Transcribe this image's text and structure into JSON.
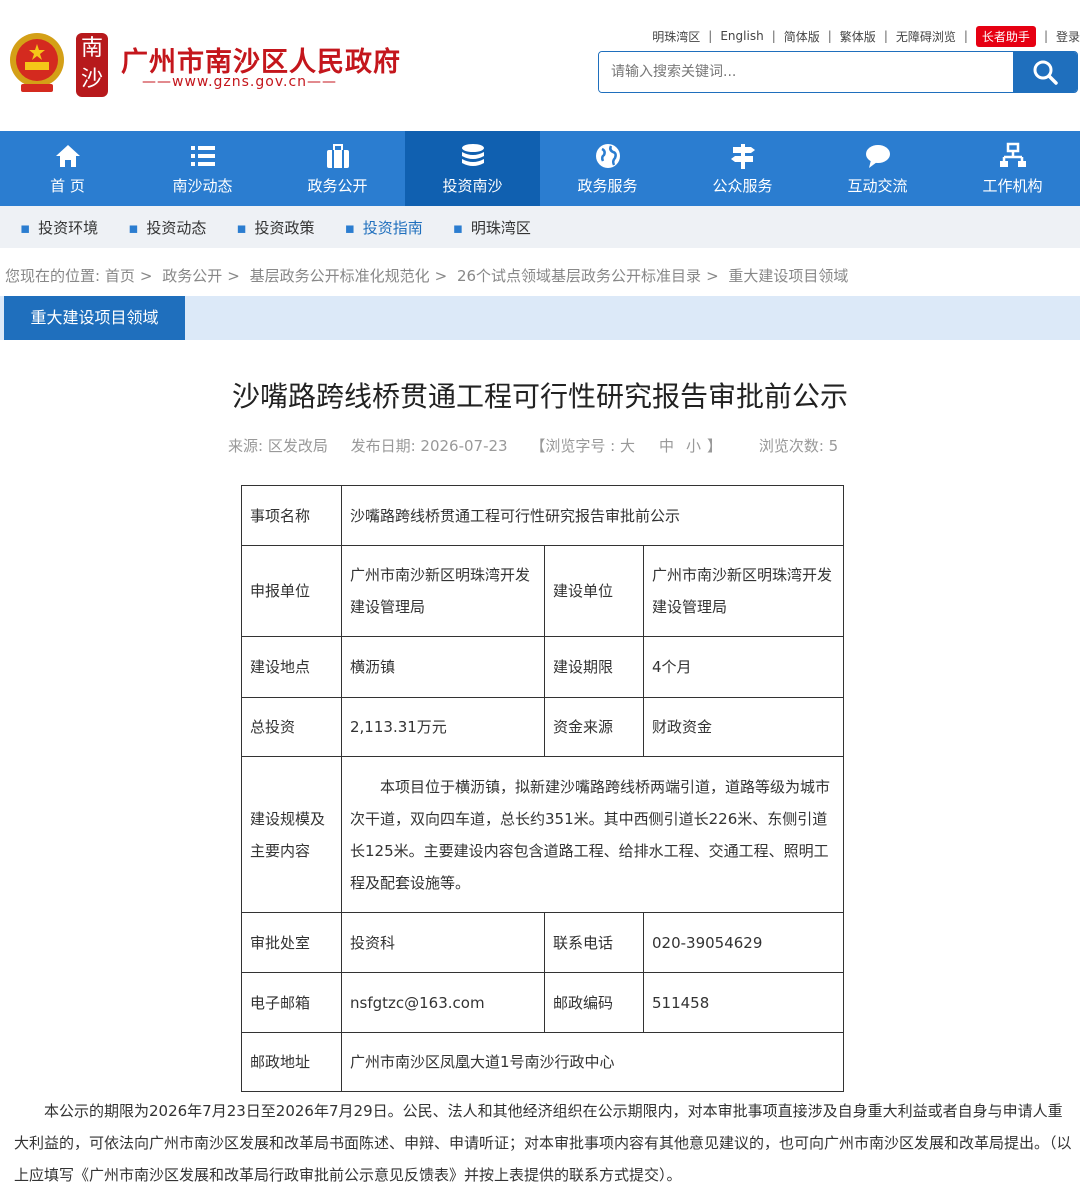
{
  "header": {
    "seal_chars": [
      "南",
      "沙"
    ],
    "site_title": "广州市南沙区人民政府",
    "site_url": "——www.gzns.gov.cn——",
    "toplinks": [
      "明珠湾区",
      "English",
      "简体版",
      "繁体版",
      "无障碍浏览"
    ],
    "elder_label": "长者助手",
    "login_label": "登录",
    "search_placeholder": "请输入搜索关键词..."
  },
  "nav": [
    {
      "label": "首 页",
      "icon": "home-icon"
    },
    {
      "label": "南沙动态",
      "icon": "list-icon"
    },
    {
      "label": "政务公开",
      "icon": "briefcase-icon"
    },
    {
      "label": "投资南沙",
      "icon": "database-icon"
    },
    {
      "label": "政务服务",
      "icon": "globe-icon"
    },
    {
      "label": "公众服务",
      "icon": "signpost-icon"
    },
    {
      "label": "互动交流",
      "icon": "chat-icon"
    },
    {
      "label": "工作机构",
      "icon": "org-chart-icon"
    }
  ],
  "subnav": [
    "投资环境",
    "投资动态",
    "投资政策",
    "投资指南",
    "明珠湾区"
  ],
  "breadcrumb": {
    "prefix": "您现在的位置:",
    "items": [
      "首页",
      "政务公开",
      "基层政务公开标准化规范化",
      "26个试点领域基层政务公开标准目录",
      "重大建设项目领域"
    ]
  },
  "column_title": "重大建设项目领域",
  "article": {
    "title": "沙嘴路跨线桥贯通工程可行性研究报告审批前公示",
    "source": "来源: 区发改局",
    "date": "发布日期: 2026-07-23",
    "fontsize_prefix": "【浏览字号 : 大",
    "fontsize_mid": "中",
    "fontsize_small": "小",
    "fontsize_suffix": "】",
    "views": "浏览次数:   5"
  },
  "table": {
    "item_name_label": "事项名称",
    "item_name": "沙嘴路跨线桥贯通工程可行性研究报告审批前公示",
    "applicant_label": "申报单位",
    "applicant": "广州市南沙新区明珠湾开发建设管理局",
    "builder_label": "建设单位",
    "builder": "广州市南沙新区明珠湾开发建设管理局",
    "site_label": "建设地点",
    "site": "横沥镇",
    "period_label": "建设期限",
    "period": "4个月",
    "investment_label": "总投资",
    "investment": "2,113.31万元",
    "fund_label": "资金来源",
    "fund": "财政资金",
    "scale_label": "建设规模及主要内容",
    "scale": "本项目位于横沥镇，拟新建沙嘴路跨线桥两端引道，道路等级为城市次干道，双向四车道，总长约351米。其中西侧引道长226米、东侧引道长125米。主要建设内容包含道路工程、给排水工程、交通工程、照明工程及配套设施等。",
    "office_label": "审批处室",
    "office": "投资科",
    "phone_label": "联系电话",
    "phone": "020-39054629",
    "email_label": "电子邮箱",
    "email": "nsfgtzc@163.com",
    "postcode_label": "邮政编码",
    "postcode": "511458",
    "address_label": "邮政地址",
    "address": "广州市南沙区凤凰大道1号南沙行政中心"
  },
  "notice": "本公示的期限为2026年7月23日至2026年7月29日。公民、法人和其他经济组织在公示期限内，对本审批事项直接涉及自身重大利益或者自身与申请人重大利益的，可依法向广州市南沙区发展和改革局书面陈述、申辩、申请听证；对本审批事项内容有其他意见建议的，也可向广州市南沙区发展和改革局提出。（以上应填写《广州市南沙区发展和改革局行政审批前公示意见反馈表》并按上表提供的联系方式提交）。",
  "colors": {
    "primary": "#2b7dd0",
    "nav_active": "#1060b0",
    "brand_red": "#c4161c",
    "elder_red": "#e60012"
  }
}
